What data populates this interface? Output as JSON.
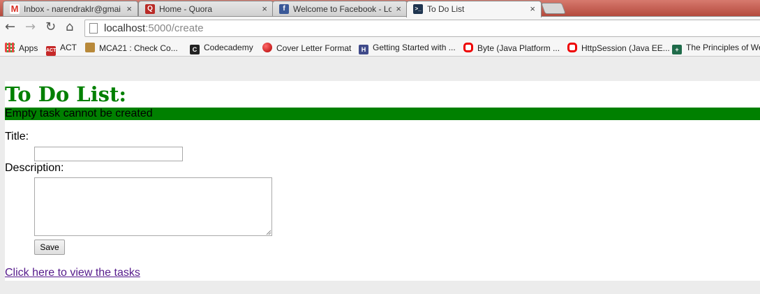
{
  "browser": {
    "tabs": [
      {
        "label": "Inbox - narendraklr@gmai",
        "icon": "gmail-icon"
      },
      {
        "label": "Home - Quora",
        "icon": "quora-icon"
      },
      {
        "label": "Welcome to Facebook - Lo",
        "icon": "facebook-icon"
      },
      {
        "label": "To Do List",
        "icon": "terminal-icon"
      }
    ],
    "close_glyph": "×",
    "url_host": "localhost",
    "url_path": ":5000/create",
    "bookmarks": [
      {
        "label": "Apps"
      },
      {
        "label": "ACT"
      },
      {
        "label": "MCA21 : Check Co..."
      },
      {
        "label": "Codecademy"
      },
      {
        "label": "Cover Letter Format"
      },
      {
        "label": "Getting Started with ..."
      },
      {
        "label": "Byte (Java Platform ..."
      },
      {
        "label": "HttpSession (Java EE..."
      },
      {
        "label": "The Principles of We"
      }
    ]
  },
  "page": {
    "title": "To Do List:",
    "flash_message": "Empty task cannot be created",
    "title_label": "Title:",
    "title_value": "",
    "description_label": "Description:",
    "description_value": "",
    "save_label": "Save",
    "view_link": "Click here to view the tasks"
  },
  "colors": {
    "heading": "#008000",
    "flash_bg": "#008000",
    "link": "#551a8b"
  }
}
